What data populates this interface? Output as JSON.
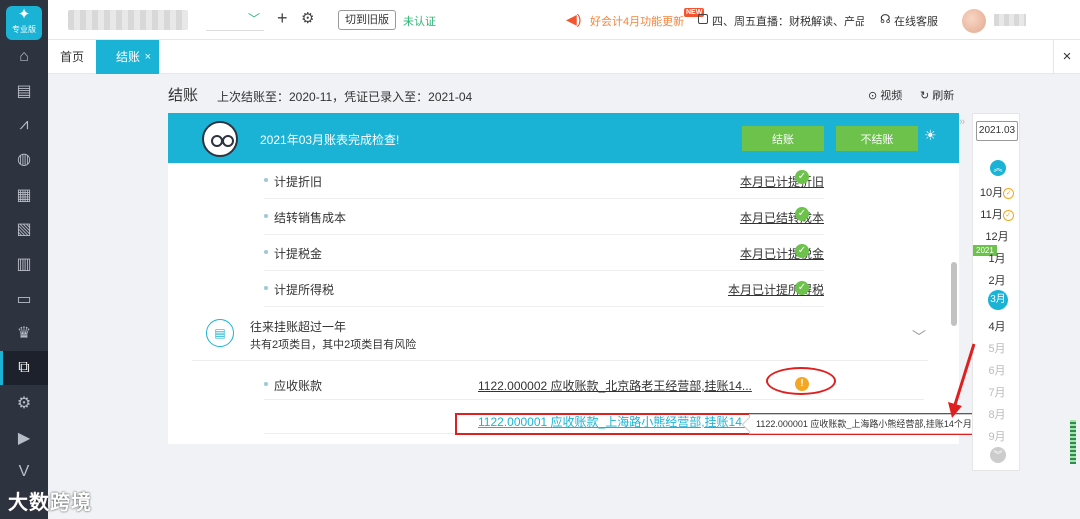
{
  "logo": {
    "glyph": "✦",
    "label": "专业版"
  },
  "sidebar": {
    "items": [
      {
        "icon": "home-icon",
        "glyph": "⌂"
      },
      {
        "icon": "voucher-icon",
        "glyph": "▤"
      },
      {
        "icon": "chart-icon",
        "glyph": "⩘"
      },
      {
        "icon": "money-bag-icon",
        "glyph": "◍"
      },
      {
        "icon": "book-icon",
        "glyph": "▦"
      },
      {
        "icon": "report-icon",
        "glyph": "▧"
      },
      {
        "icon": "store-icon",
        "glyph": "▥"
      },
      {
        "icon": "monitor-icon",
        "glyph": "▭"
      },
      {
        "icon": "stamp-icon",
        "glyph": "♛"
      },
      {
        "icon": "closing-icon",
        "glyph": "⧉"
      },
      {
        "icon": "settings-icon",
        "glyph": "⚙"
      },
      {
        "icon": "video-icon",
        "glyph": "▶"
      },
      {
        "icon": "vip-icon",
        "glyph": "V"
      }
    ]
  },
  "header": {
    "switch_label": "切到旧版",
    "verify_status": "未认证",
    "notice": "好会计4月功能更新",
    "new_badge": "NEW",
    "live_text": "四、周五直播：财税解读、产品实",
    "service": "在线客服"
  },
  "tabs": {
    "home": "首页",
    "active": "结账",
    "close": "×"
  },
  "page": {
    "title": "结账",
    "subtitle": "上次结账至：2020-11，凭证已录入至：2021-04",
    "video": "视频",
    "refresh": "刷新"
  },
  "banner": {
    "title": "2021年03月账表完成检查!",
    "close_account": "结账",
    "no_close": "不结账"
  },
  "checks": [
    {
      "name": "计提折旧",
      "status": "本月已计提折旧"
    },
    {
      "name": "结转销售成本",
      "status": "本月已结转成本"
    },
    {
      "name": "计提税金",
      "status": "本月已计提税金"
    },
    {
      "name": "计提所得税",
      "status": "本月已计提所得税"
    }
  ],
  "group": {
    "title": "往来挂账超过一年",
    "subtitle": "共有2项类目，其中2项类目有风险"
  },
  "ar": {
    "name": "应收账款",
    "item1": "1122.000002 应收账款_北京路老王经营部,挂账14...",
    "item2": "1122.000001 应收账款_上海路小熊经营部,挂账14...",
    "tooltip": "1122.000001 应收账款_上海路小熊经营部,挂账14个月"
  },
  "rail": {
    "year": "2021.03",
    "year_tag": "2021",
    "months": [
      "10月",
      "11月",
      "12月",
      "1月",
      "2月",
      "3月",
      "4月",
      "5月",
      "6月",
      "7月",
      "8月",
      "9月"
    ]
  },
  "watermark": "大数跨境",
  "colors": {
    "accent": "#1ab3d6",
    "success": "#6cc24a",
    "warning": "#f5a623",
    "highlight": "#e02020",
    "sidebar": "#2e3340"
  }
}
